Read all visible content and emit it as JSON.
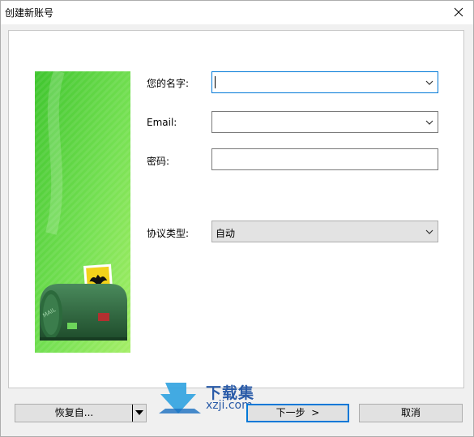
{
  "window": {
    "title": "创建新账号",
    "close_label": "Close"
  },
  "form": {
    "name_label": "您的名字:",
    "name_value": "",
    "email_label": "Email:",
    "email_value": "",
    "password_label": "密码:",
    "password_value": "",
    "protocol_label": "协议类型:",
    "protocol_value": "自动"
  },
  "buttons": {
    "restore_label": "恢复自...",
    "next_label": "下一步  >",
    "cancel_label": "取消"
  },
  "watermark": {
    "name": "下载集",
    "url": "xzji.com"
  },
  "colors": {
    "banner_green_light": "#a4ee66",
    "banner_green_dark": "#3fc52e",
    "mailbox": "#2f6b3f",
    "focus_blue": "#0078d7",
    "watermark_blue": "#2a5ba8"
  },
  "icons": {
    "close": "close-icon",
    "dropdown": "chevron-down-icon",
    "split": "triangle-down-icon",
    "banner": "mailbox-illustration"
  }
}
